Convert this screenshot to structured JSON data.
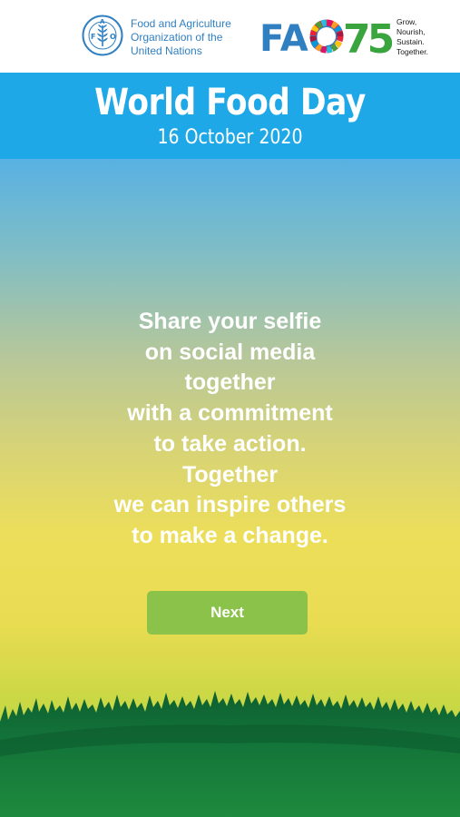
{
  "header": {
    "org_name_lines": [
      "Food and Agriculture",
      "Organization of the",
      "United Nations"
    ],
    "fao75_letters": "FAO",
    "fao75_number": "75",
    "tagline_lines": [
      "Grow,",
      "Nourish,",
      "Sustain.",
      "Together."
    ],
    "emblem_icon": "fao-emblem-icon"
  },
  "banner": {
    "title": "World Food Day",
    "date": "16 October 2020",
    "color": "#1fa8e8"
  },
  "message_lines": [
    "Share your selfie",
    "on social media",
    "together",
    "with a commitment",
    "to take action.",
    "Together",
    "we can inspire others",
    "to make a change."
  ],
  "next_button": {
    "label": "Next",
    "color": "#8bc34a"
  },
  "colors": {
    "fao_blue": "#2f7fc1",
    "fao75_green": "#3aa43f",
    "grass_dark": "#0f6b35"
  }
}
